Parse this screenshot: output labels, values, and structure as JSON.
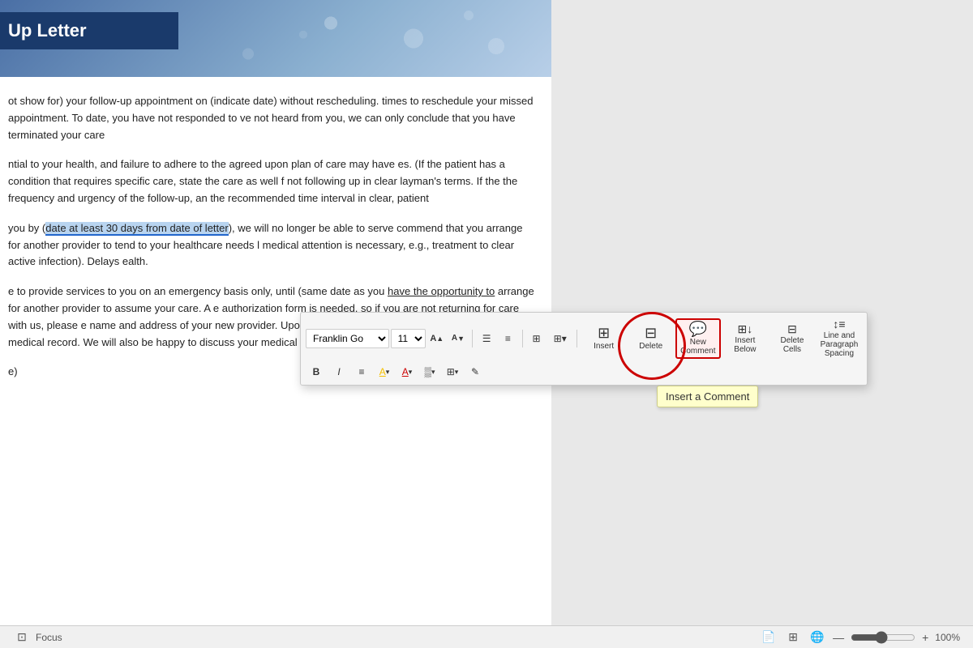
{
  "document": {
    "title": "Up Letter",
    "paragraphs": [
      "ot show for) your follow-up appointment on (indicate date) without rescheduling. times to reschedule your missed appointment. To date, you have not responded to ve not heard from you, we can only conclude that you have terminated your care",
      "ntial to your health, and failure to adhere to the agreed upon plan of care may have es. (If the patient has a condition that requires specific care, state the care as well f not following up in clear layman's terms. If the the frequency and urgency of the follow-up, an the recommended time interval in clear, patient",
      "you by (date at least 30 days from date of letter), we will no longer be able to serve commend that you arrange for another provider to tend to your healthcare needs l medical attention is necessary, e.g., treatment to clear active infection). Delays ealth.",
      "e to provide services to you on an emergency basis only, until (same date as you have the opportunity to arrange for another provider to assume your care. A e authorization form is needed, so if you are not returning for care with us, please e name and address of your new provider. Upon receipt of your signed arward a copy of your medical record. We will also be happy to discuss your medical ovider who assumes your care.",
      "e)"
    ],
    "highlighted_phrase": "date at least 30 days from date of letter"
  },
  "toolbar": {
    "font_name": "Franklin Go",
    "font_size": "11",
    "font_name_placeholder": "Franklin Go",
    "buttons": {
      "bold": "B",
      "italic": "I",
      "align": "≡",
      "highlight": "A",
      "font_color": "A",
      "shading": "░",
      "borders": "⊞",
      "pen": "✎",
      "increase_font": "A↑",
      "decrease_font": "A↓",
      "bullets": "☰",
      "numbering": "≡#"
    },
    "large_buttons": [
      {
        "id": "insert-btn",
        "icon": "⊞",
        "label": "Insert",
        "highlighted": false
      },
      {
        "id": "delete-btn",
        "icon": "⊟",
        "label": "Delete",
        "highlighted": false
      },
      {
        "id": "new-comment-btn",
        "icon": "💬",
        "label": "New Comment",
        "highlighted": true
      },
      {
        "id": "insert-below-btn",
        "icon": "⊞↓",
        "label": "Insert Below",
        "highlighted": false
      },
      {
        "id": "delete-cells-btn",
        "icon": "⊟",
        "label": "Delete Cells",
        "highlighted": false
      },
      {
        "id": "line-spacing-btn",
        "icon": "↕≡",
        "label": "Line and Paragraph Spacing",
        "highlighted": false
      }
    ]
  },
  "tooltip": {
    "text": "Insert a Comment"
  },
  "status_bar": {
    "focus_label": "Focus",
    "zoom_percent": "100%",
    "zoom_value": 100
  }
}
